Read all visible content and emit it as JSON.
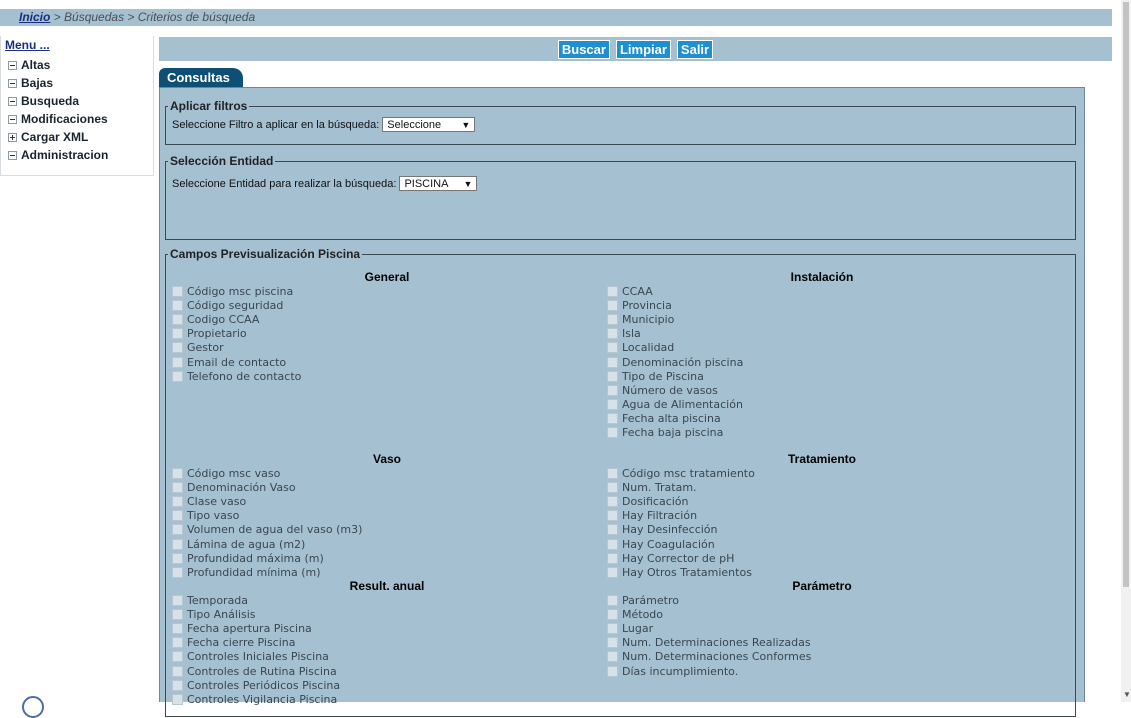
{
  "breadcrumb": {
    "home": "Inicio",
    "rest": " > Búsquedas > Criterios de búsqueda"
  },
  "menu": {
    "title": "Menu ...",
    "items": [
      {
        "label": "Altas",
        "icon": "tree-collapse-icon"
      },
      {
        "label": "Bajas",
        "icon": "tree-collapse-icon"
      },
      {
        "label": "Busqueda",
        "icon": "tree-collapse-icon"
      },
      {
        "label": "Modificaciones",
        "icon": "tree-collapse-icon"
      },
      {
        "label": "Cargar XML",
        "icon": "tree-expand-icon"
      },
      {
        "label": "Administracion",
        "icon": "tree-collapse-icon"
      }
    ]
  },
  "toolbar": {
    "search": "Buscar",
    "clear": "Limpiar",
    "exit": "Salir"
  },
  "tab": {
    "label": "Consultas"
  },
  "filters": {
    "legend": "Aplicar filtros",
    "label": "Seleccione Filtro a aplicar en la búsqueda:",
    "selected": "Seleccione"
  },
  "entity": {
    "legend": "Selección Entidad",
    "label": "Seleccione Entidad para realizar la búsqueda:",
    "selected": "PISCINA"
  },
  "fields": {
    "legend": "Campos Previsualización Piscina",
    "general": {
      "title": "General",
      "items": [
        "Código msc piscina",
        "Código seguridad",
        "Codigo CCAA",
        "Propietario",
        "Gestor",
        "Email de contacto",
        "Telefono de contacto"
      ]
    },
    "instalacion": {
      "title": "Instalación",
      "items": [
        "CCAA",
        "Provincia",
        "Municipio",
        "Isla",
        "Localidad",
        "Denominación piscina",
        "Tipo de Piscina",
        "Número de vasos",
        "Agua de Alimentación",
        "Fecha alta piscina",
        "Fecha baja piscina"
      ]
    },
    "vaso": {
      "title": "Vaso",
      "items": [
        "Código msc vaso",
        "Denominación Vaso",
        "Clase vaso",
        "Tipo vaso",
        "Volumen de agua del vaso (m3)",
        "Lámina de agua (m2)",
        "Profundidad máxima (m)",
        "Profundidad mínima (m)"
      ]
    },
    "tratamiento": {
      "title": "Tratamiento",
      "items": [
        "Código msc tratamiento",
        "Num. Tratam.",
        "Dosificación",
        "Hay Filtración",
        "Hay Desinfección",
        "Hay Coagulación",
        "Hay Corrector de pH",
        "Hay Otros Tratamientos"
      ]
    },
    "resultado": {
      "title": "Result. anual",
      "items": [
        "Temporada",
        "Tipo Análisis",
        "Fecha apertura Piscina",
        "Fecha cierre Piscina",
        "Controles Iniciales Piscina",
        "Controles de Rutina Piscina",
        "Controles Periódicos Piscina",
        "Controles Vigilancia Piscina"
      ]
    },
    "parametro": {
      "title": "Parámetro",
      "items": [
        "Parámetro",
        "Método",
        "Lugar",
        "Num. Determinaciones Realizadas",
        "Num. Determinaciones Conformes",
        "Días incumplimiento."
      ]
    }
  }
}
